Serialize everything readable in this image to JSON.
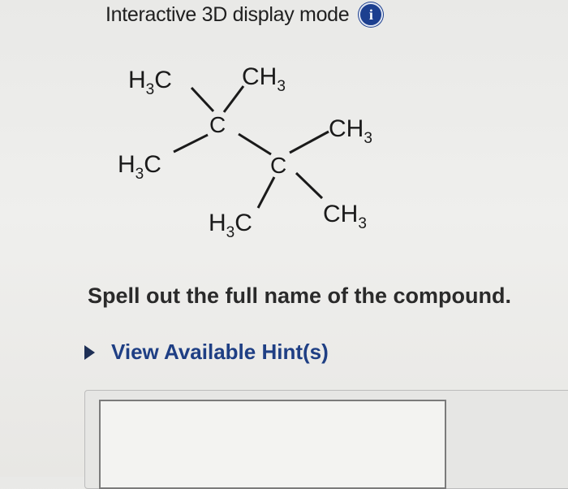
{
  "header": {
    "mode_label": "Interactive 3D display mode",
    "info_glyph": "i"
  },
  "molecule": {
    "labels": {
      "top_left_methyl": [
        "H",
        "3",
        "C"
      ],
      "top_right_methyl": [
        "CH",
        "3"
      ],
      "left_methyl": [
        "H",
        "3",
        "C"
      ],
      "carbon_1": "C",
      "carbon_2": "C",
      "right_upper_methyl": [
        "CH",
        "3"
      ],
      "bottom_left_methyl": [
        "H",
        "3",
        "C"
      ],
      "right_lower_methyl": [
        "CH",
        "3"
      ]
    }
  },
  "question": {
    "prompt": "Spell out the full name of the compound."
  },
  "hint": {
    "label": "View Available Hint(s)",
    "icon": "triangle-right-icon"
  },
  "answer": {
    "value": "",
    "placeholder": ""
  },
  "colors": {
    "accent_blue": "#1c3f8f",
    "hint_blue": "#1f3f84",
    "text": "#1a1a1a"
  }
}
